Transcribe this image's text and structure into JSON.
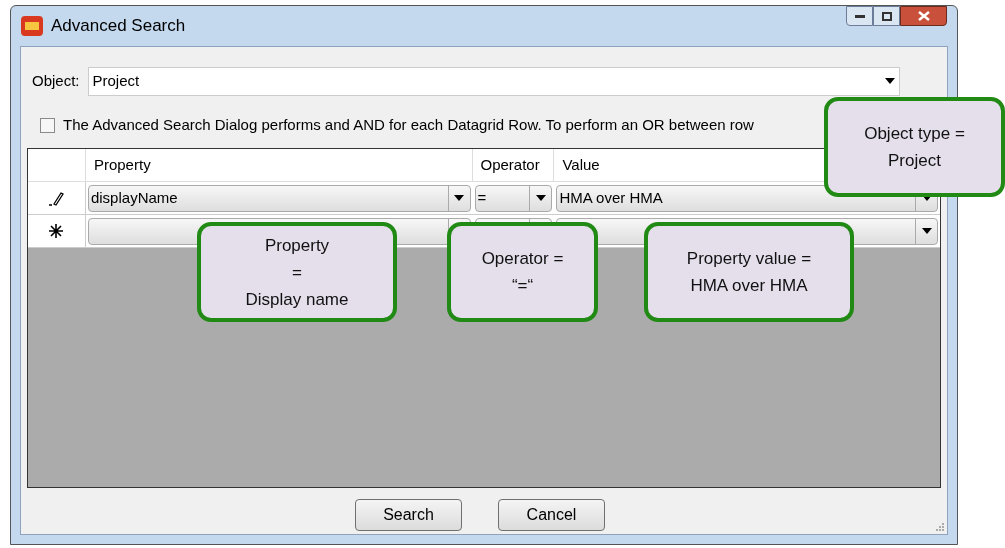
{
  "window": {
    "title": "Advanced Search"
  },
  "object_field": {
    "label": "Object:",
    "value": "Project"
  },
  "option": {
    "label": "The Advanced Search Dialog performs and AND for each Datagrid Row.  To perform an OR between row",
    "checked": false
  },
  "grid": {
    "columns": [
      "Property",
      "Operator",
      "Value"
    ],
    "rows": [
      {
        "kind": "editing",
        "cells": [
          "displayName",
          "=",
          "HMA over HMA"
        ]
      },
      {
        "kind": "new"
      }
    ]
  },
  "buttons": [
    "Search",
    "Cancel"
  ],
  "callouts": [
    {
      "text": "Object type =\nProject"
    },
    {
      "text": "Property\n=\nDisplay name"
    },
    {
      "text": "Operator =\n“=“"
    },
    {
      "text": "Property value =\nHMA over HMA"
    }
  ]
}
